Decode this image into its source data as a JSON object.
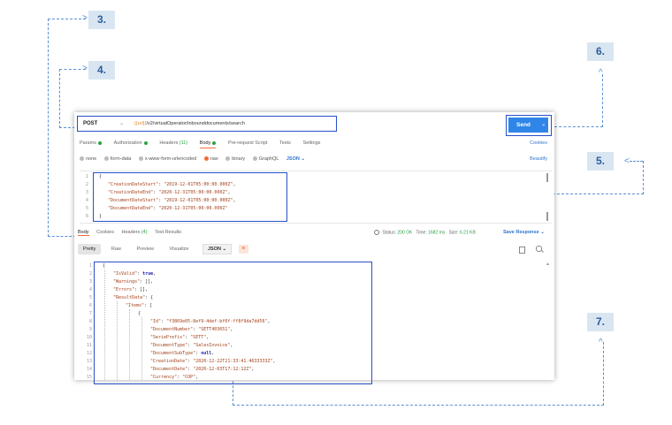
{
  "callouts": {
    "c3": "3.",
    "c4": "4.",
    "c5": "5.",
    "c6": "6.",
    "c7": "7."
  },
  "request": {
    "method": "POST",
    "url_var": "{{url}}",
    "url_path": "/v2/virtualOperator/inbounddocuments/search",
    "send_label": "Send"
  },
  "request_tabs": {
    "params": "Params",
    "authorization": "Authorization",
    "headers": "Headers",
    "headers_count": "(11)",
    "body": "Body",
    "pre_request": "Pre-request Script",
    "tests": "Tests",
    "settings": "Settings",
    "cookies": "Cookies"
  },
  "body_types": {
    "none": "none",
    "form_data": "form-data",
    "urlencoded": "x-www-form-urlencoded",
    "raw": "raw",
    "binary": "binary",
    "graphql": "GraphQL",
    "format": "JSON",
    "beautify": "Beautify"
  },
  "request_body": {
    "line_numbers": [
      "1",
      "2",
      "3",
      "4",
      "5",
      "6"
    ],
    "l1": "{",
    "l2_key": "\"CreationDateStart\"",
    "l2_val": "\"2019-12-01T05:00:00.000Z\"",
    "l3_key": "\"CreationDateEnd\"",
    "l3_val": "\"2020-12-31T05:00:00.000Z\"",
    "l4_key": "\"DocumentDateStart\"",
    "l4_val": "\"2019-12-01T05:00:00.000Z\"",
    "l5_key": "\"DocumentDateEnd\"",
    "l5_val": "\"2020-12-31T05:00:00.000Z\"",
    "l6": "}"
  },
  "response_tabs": {
    "body": "Body",
    "cookies": "Cookies",
    "headers": "Headers",
    "headers_count": "(4)",
    "test_results": "Test Results"
  },
  "status": {
    "status_label": "Status:",
    "status_value": "200 OK",
    "time_label": "Time:",
    "time_value": "1682 ms",
    "size_label": "Size:",
    "size_value": "6.21 KB",
    "save_response": "Save Response"
  },
  "view_bar": {
    "pretty": "Pretty",
    "raw": "Raw",
    "preview": "Preview",
    "visualize": "Visualize",
    "format": "JSON"
  },
  "response_body": {
    "line_numbers": [
      "1",
      "2",
      "3",
      "4",
      "5",
      "6",
      "7",
      "8",
      "9",
      "10",
      "11",
      "12",
      "13",
      "14",
      "15"
    ],
    "l1": "{",
    "l2_key": "\"IsValid\"",
    "l2_val": "true",
    "l3_key": "\"Warnings\"",
    "l3_val": "[],",
    "l4_key": "\"Errors\"",
    "l4_val": "[],",
    "l5_key": "\"ResultData\"",
    "l5_val": "{",
    "l6_key": "\"Items\"",
    "l6_val": "[",
    "l7": "{",
    "l8_key": "\"Id\"",
    "l8_val": "\"f3869e05-8ef9-4def-bf0f-ff8f9da7dd56\"",
    "l9_key": "\"DocumentNumber\"",
    "l9_val": "\"SETT403651\"",
    "l10_key": "\"SeriePrefix\"",
    "l10_val": "\"SETT\"",
    "l11_key": "\"DocumentType\"",
    "l11_val": "\"SalesInvoice\"",
    "l12_key": "\"DocumentSubType\"",
    "l12_val": "null",
    "l13_key": "\"CreationDate\"",
    "l13_val": "\"2020-12-22T21:33:41.4633333Z\"",
    "l14_key": "\"DocumentDate\"",
    "l14_val": "\"2020-12-03T17:12:12Z\"",
    "l15_key": "\"Currency\"",
    "l15_val": "\"COP\""
  },
  "colors": {
    "accent": "#f26b3a",
    "send": "#2f86e8",
    "highlight": "#2550c9",
    "callout_bg": "#d9e6f2"
  }
}
